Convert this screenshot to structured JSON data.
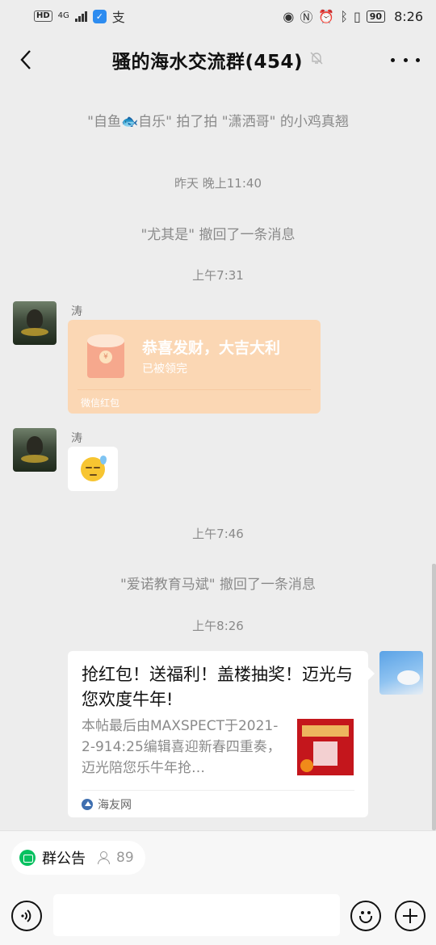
{
  "status_bar": {
    "hd_badge": "HD",
    "network": "4G",
    "app_glyph": "✓",
    "pay_glyph": "支",
    "battery": "90",
    "time": "8:26"
  },
  "header": {
    "title": "骚的海水交流群(454)",
    "mute_icon": "bell-off-icon",
    "more_icon": "ellipsis-icon"
  },
  "messages": {
    "pat_notice": "\"自鱼🐟自乐\" 拍了拍 \"潇洒哥\" 的小鸡真翘",
    "ts1": "昨天 晚上11:40",
    "recall1": "\"尤其是\" 撤回了一条消息",
    "ts2": "上午7:31",
    "sender1": "涛",
    "redpacket": {
      "title": "恭喜发财，大吉大利",
      "status": "已被领完",
      "footer": "微信红包",
      "bg_color": "#fbd7b4"
    },
    "sender2": "涛",
    "emoji_name": "sweat-smile-emoji",
    "ts3": "上午7:46",
    "recall2": "\"爱诺教育马斌\" 撤回了一条消息",
    "ts4": "上午8:26",
    "link_card": {
      "title": "抢红包！送福利！盖楼抽奖！迈光与您欢度牛年!",
      "description": "本帖最后由MAXSPECT于2021-2-914:25编辑喜迎新春四重奏，迈光陪您乐牛年抢…",
      "source": "海友网"
    }
  },
  "bottom": {
    "notice_label": "群公告",
    "member_count": "89",
    "input_value": ""
  },
  "colors": {
    "background": "#ededed",
    "accent_green": "#07c160",
    "text_gray": "#8a8a8a"
  }
}
